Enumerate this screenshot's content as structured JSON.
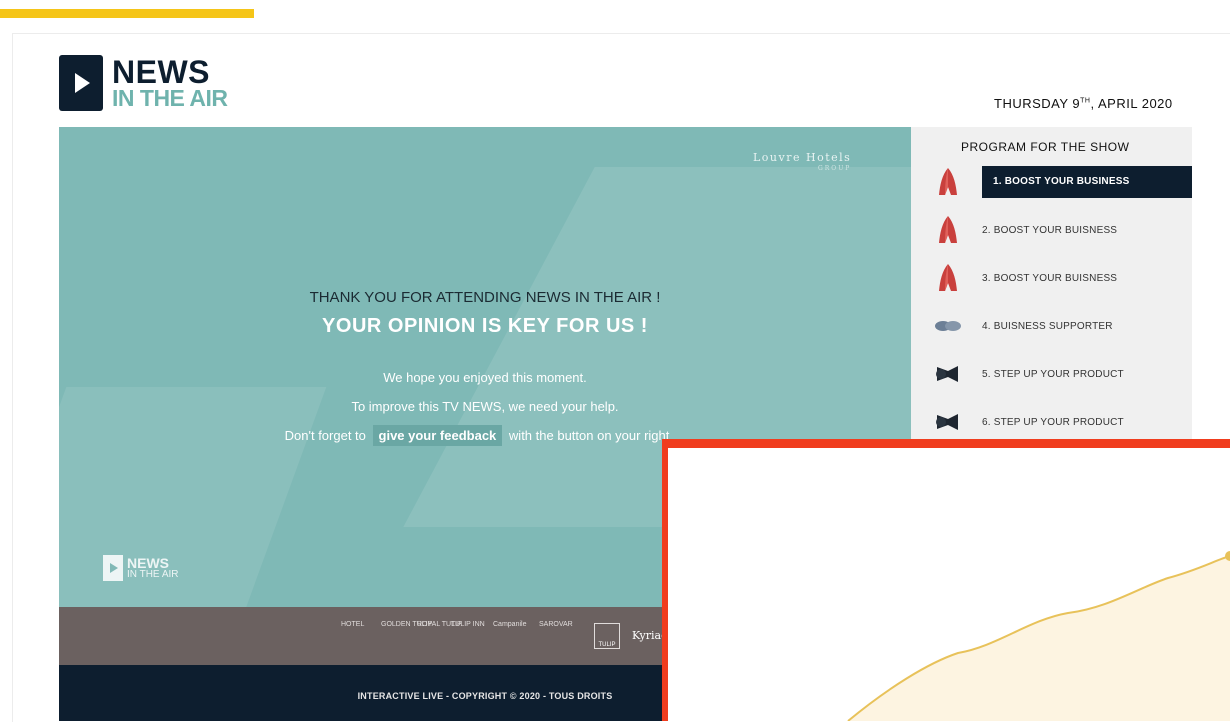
{
  "header": {
    "logo_news": "NEWS",
    "logo_in_the_air": "IN THE AIR",
    "date_prefix": "THURSDAY 9",
    "date_sup": "TH",
    "date_suffix": ", APRIL 2020"
  },
  "hero": {
    "brand": "Louvre Hotels",
    "brand_sub": "GROUP",
    "heading": "THANK YOU FOR ATTENDING NEWS IN THE AIR !",
    "subheading": "YOUR OPINION IS KEY FOR US !",
    "line1": "We hope you enjoyed this moment.",
    "line2": "To improve this TV NEWS, we need your help.",
    "line3_before": "Don't forget to",
    "feedback_button": "give your feedback",
    "line3_after": "with the button on your right",
    "small_logo_news": "NEWS",
    "small_logo_air": "IN THE AIR"
  },
  "partners": {
    "logos": [
      "HOTEL",
      "GOLDEN TULIP",
      "ROYAL TULIP",
      "TULIP INN",
      "Campanile",
      "SAROVAR"
    ],
    "tulip_box": "TULIP",
    "kyriad": "Kyriad"
  },
  "footer": {
    "copyright": "INTERACTIVE LIVE - COPYRIGHT © 2020 - TOUS DROITS"
  },
  "sidebar": {
    "title": "PROGRAM FOR THE SHOW",
    "items": [
      {
        "label": "1. BOOST YOUR BUSINESS",
        "icon": "rocket-icon",
        "active": true
      },
      {
        "label": "2. BOOST YOUR BUISNESS",
        "icon": "rocket-icon",
        "active": false
      },
      {
        "label": "3. BOOST YOUR BUISNESS",
        "icon": "rocket-icon",
        "active": false
      },
      {
        "label": "4. BUISNESS SUPPORTER",
        "icon": "handshake-icon",
        "active": false
      },
      {
        "label": "5. STEP UP YOUR PRODUCT",
        "icon": "megaphone-icon",
        "active": false
      },
      {
        "label": "6. STEP UP YOUR PRODUCT",
        "icon": "megaphone-icon",
        "active": false
      }
    ]
  },
  "colors": {
    "accent_yellow": "#f5c518",
    "teal": "#7fb9b6",
    "navy": "#0d1e2f",
    "overlay_red": "#f03d1e",
    "chart_line": "#e8c25a"
  }
}
